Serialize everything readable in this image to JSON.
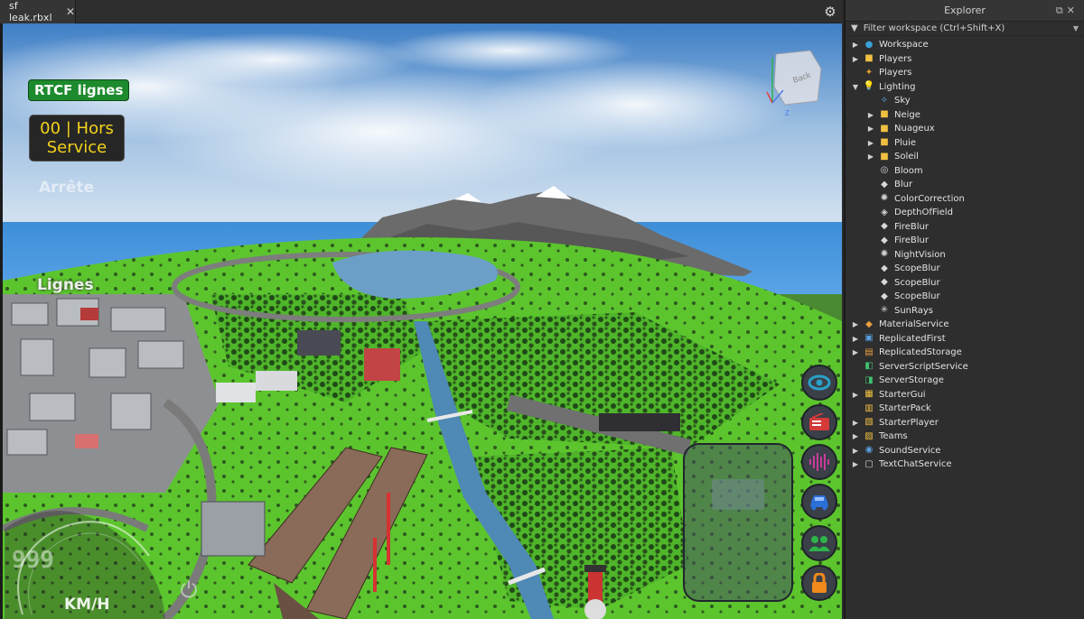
{
  "tab": {
    "title": "sf leak.rbxl",
    "close_glyph": "✕"
  },
  "toolbar": {
    "settings_glyph": "⚙"
  },
  "hud": {
    "rtcf_label": "RTCF lignes",
    "line_status_line1": "00 | Hors",
    "line_status_line2": "Service",
    "stop_label": "Arrête",
    "lines_label": "Lignes",
    "speed_value": "999",
    "speed_unit": "KM/H",
    "colors": {
      "badge_green": "#1c8a2d",
      "status_yellow": "#f2d21b"
    }
  },
  "right_buttons": [
    {
      "icon": "eye-icon",
      "color": "#2aa0c8"
    },
    {
      "icon": "radio-icon",
      "color": "#d33a3a"
    },
    {
      "icon": "audio-wave-icon",
      "color": "#c93c9a"
    },
    {
      "icon": "car-icon",
      "color": "#2c6fd6"
    },
    {
      "icon": "group-icon",
      "color": "#2db34a"
    },
    {
      "icon": "lock-icon",
      "color": "#f08a1c"
    }
  ],
  "viewcube": {
    "face_label": "Back",
    "axis_z": "Z"
  },
  "explorer": {
    "title": "Explorer",
    "filter_placeholder": "Filter workspace (Ctrl+Shift+X)",
    "items": [
      {
        "label": "Workspace",
        "icon": "globe-icon",
        "arrow": "▶",
        "color": "#3aa0d8"
      },
      {
        "label": "Players",
        "icon": "folder-icon",
        "arrow": "▶",
        "color": "#f0c040"
      },
      {
        "label": "Players",
        "icon": "players-icon",
        "arrow": "",
        "color": "#e0a030"
      },
      {
        "label": "Lighting",
        "icon": "bulb-icon",
        "arrow": "▼",
        "color": "#f0d030"
      },
      {
        "label": "Sky",
        "icon": "sky-icon",
        "arrow": "",
        "color": "#5aa8e8",
        "child": true
      },
      {
        "label": "Neige",
        "icon": "folder-icon",
        "arrow": "▶",
        "color": "#f0c040",
        "child": true
      },
      {
        "label": "Nuageux",
        "icon": "folder-icon",
        "arrow": "▶",
        "color": "#f0c040",
        "child": true
      },
      {
        "label": "Pluie",
        "icon": "folder-icon",
        "arrow": "▶",
        "color": "#f0c040",
        "child": true
      },
      {
        "label": "Soleil",
        "icon": "folder-icon",
        "arrow": "▶",
        "color": "#f0c040",
        "child": true
      },
      {
        "label": "Bloom",
        "icon": "bloom-icon",
        "arrow": "",
        "color": "#d8d8d8",
        "child": true
      },
      {
        "label": "Blur",
        "icon": "drop-icon",
        "arrow": "",
        "color": "#d8d8d8",
        "child": true
      },
      {
        "label": "ColorCorrection",
        "icon": "sun-cog-icon",
        "arrow": "",
        "color": "#d8d8d8",
        "child": true
      },
      {
        "label": "DepthOfField",
        "icon": "depth-icon",
        "arrow": "",
        "color": "#d8d8d8",
        "child": true
      },
      {
        "label": "FireBlur",
        "icon": "drop-icon",
        "arrow": "",
        "color": "#d8d8d8",
        "child": true
      },
      {
        "label": "FireBlur",
        "icon": "drop-icon",
        "arrow": "",
        "color": "#d8d8d8",
        "child": true
      },
      {
        "label": "NightVision",
        "icon": "sun-cog-icon",
        "arrow": "",
        "color": "#d8d8d8",
        "child": true
      },
      {
        "label": "ScopeBlur",
        "icon": "drop-icon",
        "arrow": "",
        "color": "#d8d8d8",
        "child": true
      },
      {
        "label": "ScopeBlur",
        "icon": "drop-icon",
        "arrow": "",
        "color": "#d8d8d8",
        "child": true
      },
      {
        "label": "ScopeBlur",
        "icon": "drop-icon",
        "arrow": "",
        "color": "#d8d8d8",
        "child": true
      },
      {
        "label": "SunRays",
        "icon": "sunrays-icon",
        "arrow": "",
        "color": "#d8d8d8",
        "child": true
      },
      {
        "label": "MaterialService",
        "icon": "material-icon",
        "arrow": "▶",
        "color": "#e8a040"
      },
      {
        "label": "ReplicatedFirst",
        "icon": "replicated-first-icon",
        "arrow": "▶",
        "color": "#5aa0e0"
      },
      {
        "label": "ReplicatedStorage",
        "icon": "replicated-storage-icon",
        "arrow": "▶",
        "color": "#e8a040"
      },
      {
        "label": "ServerScriptService",
        "icon": "server-script-icon",
        "arrow": "",
        "color": "#40c070"
      },
      {
        "label": "ServerStorage",
        "icon": "server-storage-icon",
        "arrow": "",
        "color": "#40c070"
      },
      {
        "label": "StarterGui",
        "icon": "starter-gui-icon",
        "arrow": "▶",
        "color": "#f0c040"
      },
      {
        "label": "StarterPack",
        "icon": "starter-pack-icon",
        "arrow": "",
        "color": "#f0c040"
      },
      {
        "label": "StarterPlayer",
        "icon": "starter-player-icon",
        "arrow": "▶",
        "color": "#f0c040"
      },
      {
        "label": "Teams",
        "icon": "teams-icon",
        "arrow": "▶",
        "color": "#f0c040"
      },
      {
        "label": "SoundService",
        "icon": "sound-icon",
        "arrow": "▶",
        "color": "#5aa0e0"
      },
      {
        "label": "TextChatService",
        "icon": "chat-icon",
        "arrow": "▶",
        "color": "#d8d8d8"
      }
    ]
  }
}
